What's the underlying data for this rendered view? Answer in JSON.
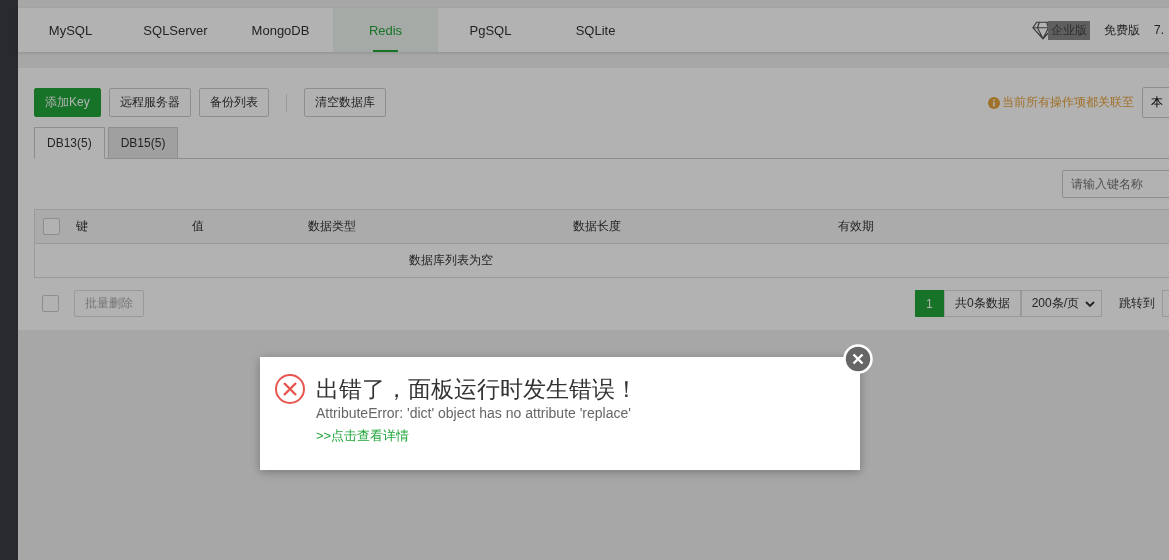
{
  "nav": {
    "tabs": [
      {
        "label": "MySQL",
        "selected": false
      },
      {
        "label": "SQLServer",
        "selected": false
      },
      {
        "label": "MongoDB",
        "selected": false
      },
      {
        "label": "Redis",
        "selected": true
      },
      {
        "label": "PgSQL",
        "selected": false
      },
      {
        "label": "SQLite",
        "selected": false
      }
    ],
    "badge": "企业版",
    "edition": "免费版",
    "version": "7."
  },
  "toolbar": {
    "button_groups": [
      [
        {
          "label": "添加Key",
          "kind": "primary"
        },
        {
          "label": "远程服务器",
          "kind": "default"
        },
        {
          "label": "备份列表",
          "kind": "default"
        }
      ],
      [
        {
          "label": "清空数据库",
          "kind": "default"
        }
      ]
    ],
    "notice": "当前所有操作项都关联至",
    "server_select": "本"
  },
  "db_tabs": [
    {
      "label": "DB13(5)",
      "selected": true
    },
    {
      "label": "DB15(5)",
      "selected": false
    }
  ],
  "search": {
    "placeholder": "请输入键名称"
  },
  "table": {
    "select_all": {
      "checked": false
    },
    "columns": [
      "键",
      "值",
      "数据类型",
      "数据长度",
      "有效期"
    ],
    "empty": "数据库列表为空"
  },
  "footer": {
    "select_all": {
      "checked": false
    },
    "bulk_delete": {
      "label": "批量删除",
      "disabled": true
    },
    "pages": [
      {
        "label": "1",
        "selected": true
      }
    ],
    "total": "共0条数据",
    "per_page": "200条/页",
    "jump": "跳转到"
  },
  "dialog": {
    "title": "出错了，面板运行时发生错误！",
    "message": "AttributeError: 'dict' object has no attribute 'replace'",
    "link": ">>点击查看详情"
  }
}
